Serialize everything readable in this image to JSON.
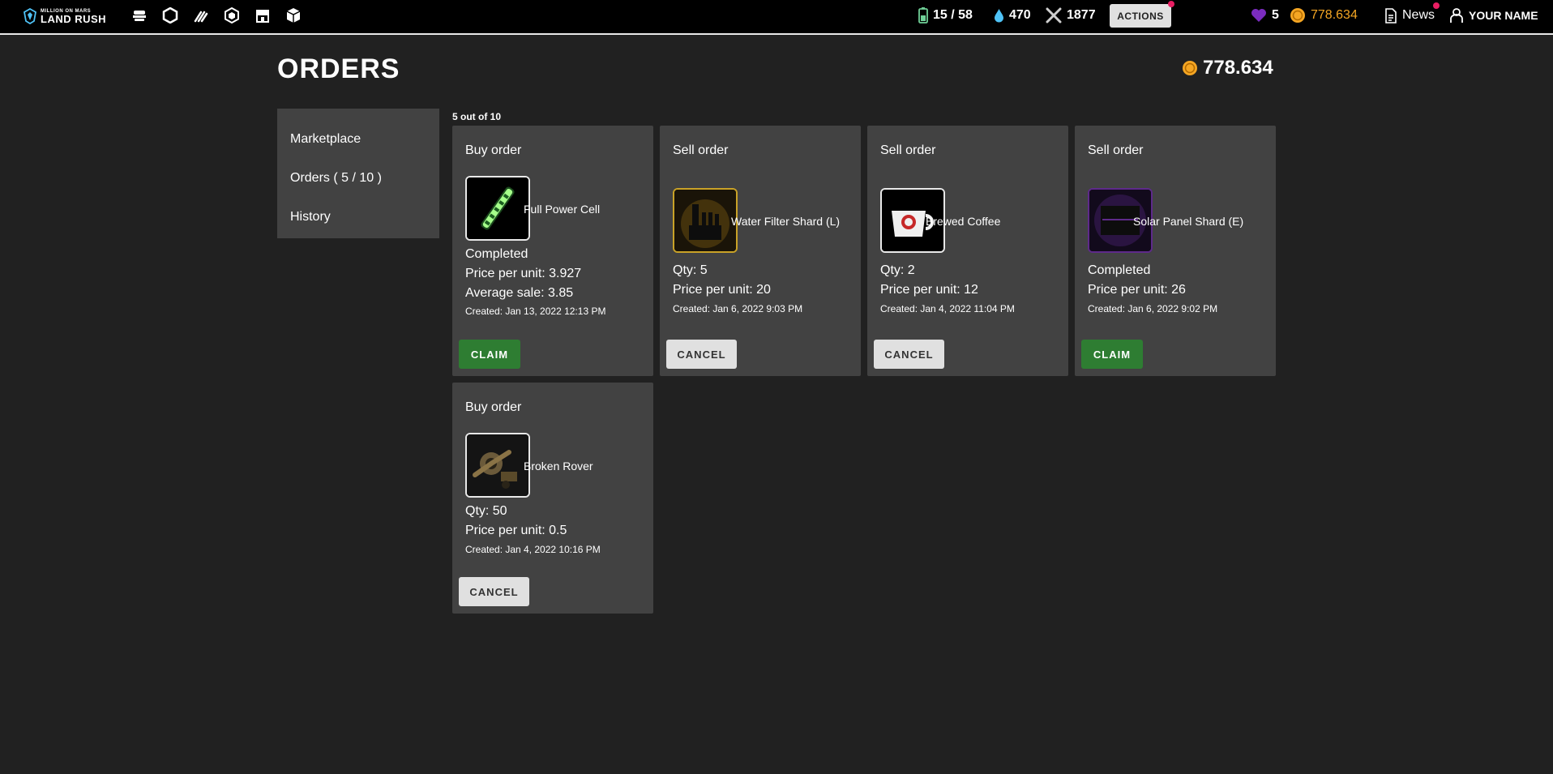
{
  "topbar": {
    "logo_small": "MILLION ON MARS",
    "logo_big": "LAND RUSH",
    "nav_icons": [
      "rover-nav-icon",
      "hexagon-nav-icon",
      "mining-nav-icon",
      "cube-nav-icon",
      "store-nav-icon",
      "box-nav-icon"
    ],
    "energy": "15 / 58",
    "water": "470",
    "tools": "1877",
    "actions_label": "ACTIONS",
    "hearts": "5",
    "coins": "778.634",
    "news_label": "News",
    "user_label": "YOUR NAME",
    "colors": {
      "coin": "#f5a623",
      "heart": "#7b2cbf",
      "water": "#4fc3f7",
      "energy": "#6fcf97",
      "notification": "#e91e63"
    }
  },
  "page": {
    "title": "ORDERS",
    "balance": "778.634"
  },
  "sidebar": {
    "items": [
      {
        "label": "Marketplace"
      },
      {
        "label": "Orders ( 5 / 10 )"
      },
      {
        "label": "History"
      }
    ]
  },
  "orders": {
    "count_label": "5 out of 10",
    "cards": [
      {
        "title": "Buy order",
        "item": "Full Power Cell",
        "line1": "Completed",
        "line2": "Price per unit: 3.927",
        "line3": "Average sale: 3.85",
        "created": "Created: Jan 13, 2022 12:13 PM",
        "button": "CLAIM",
        "icon": "power-cell-icon"
      },
      {
        "title": "Sell order",
        "item": "Water Filter Shard (L)",
        "line1": "Qty: 5",
        "line2": "Price per unit: 20",
        "created": "Created: Jan 6, 2022 9:03 PM",
        "button": "CANCEL",
        "icon": "water-filter-icon"
      },
      {
        "title": "Sell order",
        "item": "Brewed Coffee",
        "line1": "Qty: 2",
        "line2": "Price per unit: 12",
        "created": "Created: Jan 4, 2022 11:04 PM",
        "button": "CANCEL",
        "icon": "coffee-cup-icon"
      },
      {
        "title": "Sell order",
        "item": "Solar Panel Shard (E)",
        "line1": "Completed",
        "line2": "Price per unit: 26",
        "created": "Created: Jan 6, 2022 9:02 PM",
        "button": "CLAIM",
        "icon": "solar-panel-icon"
      },
      {
        "title": "Buy order",
        "item": "Broken Rover",
        "line1": "Qty: 50",
        "line2": "Price per unit: 0.5",
        "created": "Created: Jan 4, 2022 10:16 PM",
        "button": "CANCEL",
        "icon": "broken-rover-icon"
      }
    ]
  }
}
